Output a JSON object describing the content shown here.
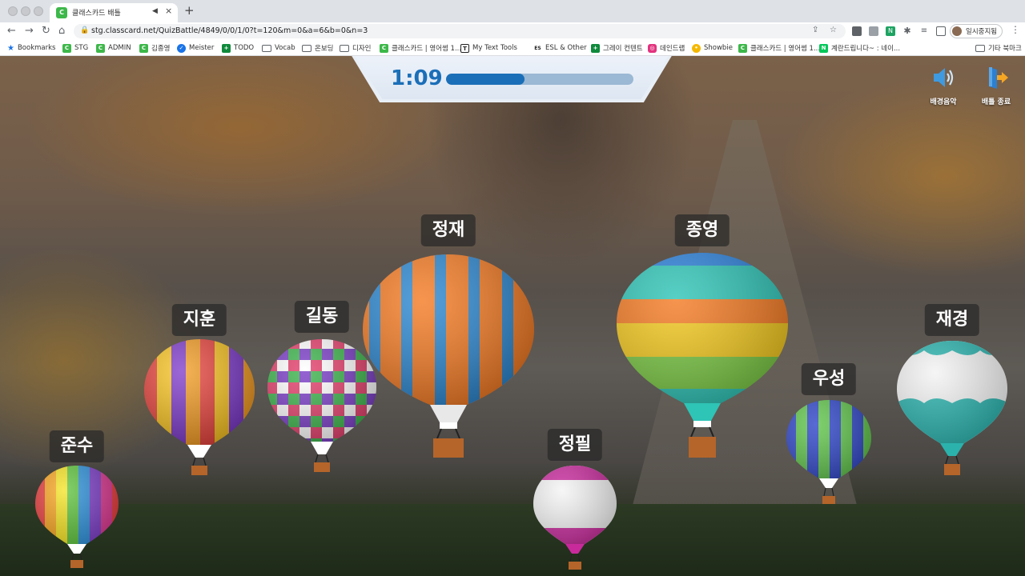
{
  "browser": {
    "tab": {
      "title": "클래스카드 배틀",
      "favicon": "C"
    },
    "url": "stg.classcard.net/QuizBattle/4849/0/0/1/0?t=120&m=0&a=6&b=0&n=3",
    "profile_name": "일시중지됨",
    "bookmarks": [
      {
        "label": "Bookmarks",
        "icon": "star-icon"
      },
      {
        "label": "STG",
        "icon": "classcard-icon"
      },
      {
        "label": "ADMIN",
        "icon": "classcard-icon"
      },
      {
        "label": "김종영",
        "icon": "classcard-icon"
      },
      {
        "label": "Meister",
        "icon": "check-icon"
      },
      {
        "label": "TODO",
        "icon": "plus-icon"
      },
      {
        "label": "Vocab",
        "icon": "folder-icon"
      },
      {
        "label": "온보딩",
        "icon": "folder-icon"
      },
      {
        "label": "디자인",
        "icon": "folder-icon"
      },
      {
        "label": "클래스카드 | 영어썸 1...",
        "icon": "classcard-icon"
      },
      {
        "label": "My Text Tools",
        "icon": "tools-icon"
      },
      {
        "label": "ESL & Other",
        "icon": "esl-icon"
      },
      {
        "label": "그레이 컨텐트",
        "icon": "plus-icon"
      },
      {
        "label": "데인드랩",
        "icon": "lab-icon"
      },
      {
        "label": "Showbie",
        "icon": "showbie-icon"
      },
      {
        "label": "클래스카드 | 영어썸 1...",
        "icon": "classcard-icon"
      },
      {
        "label": "계란드립니다~ : 네이...",
        "icon": "naver-icon"
      },
      {
        "label": "기타 북마크",
        "icon": "folder-icon"
      }
    ]
  },
  "game": {
    "timer": "1:09",
    "progress": 0.42,
    "controls": {
      "music_label": "배경음악",
      "exit_label": "배틀 종료"
    },
    "players": [
      {
        "name": "준수",
        "style": "rainbow-stripes"
      },
      {
        "name": "지훈",
        "style": "yellow-purple-red"
      },
      {
        "name": "길동",
        "style": "checker"
      },
      {
        "name": "정재",
        "style": "orange-blue"
      },
      {
        "name": "정필",
        "style": "pink-white"
      },
      {
        "name": "종영",
        "style": "horizontal-bands"
      },
      {
        "name": "우성",
        "style": "blue-green"
      },
      {
        "name": "재경",
        "style": "teal-white"
      }
    ],
    "colors": {
      "timer_blue": "#1b6fb8",
      "progress_track": "#9bb8d4"
    }
  }
}
